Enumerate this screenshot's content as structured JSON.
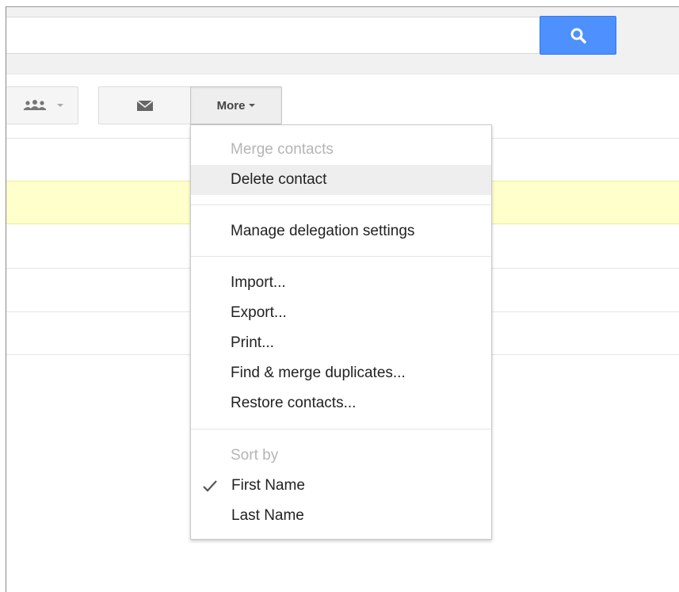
{
  "search": {
    "value": "",
    "placeholder": ""
  },
  "toolbar": {
    "groups_icon": "people-icon",
    "mail_icon": "envelope-icon",
    "more_label": "More"
  },
  "menu": {
    "items": [
      {
        "label": "Merge contacts",
        "disabled": true
      },
      {
        "label": "Delete contact",
        "highlighted": true
      },
      {
        "label": "Manage delegation settings"
      },
      {
        "label": "Import..."
      },
      {
        "label": "Export..."
      },
      {
        "label": "Print..."
      },
      {
        "label": "Find & merge duplicates..."
      },
      {
        "label": "Restore contacts..."
      }
    ],
    "sort": {
      "heading": "Sort by",
      "options": [
        {
          "label": "First Name",
          "checked": true
        },
        {
          "label": "Last Name",
          "checked": false
        }
      ]
    }
  },
  "colors": {
    "search_button": "#4d90fe",
    "selected_row": "#ffffcc",
    "menu_highlight": "#eeeeee"
  }
}
